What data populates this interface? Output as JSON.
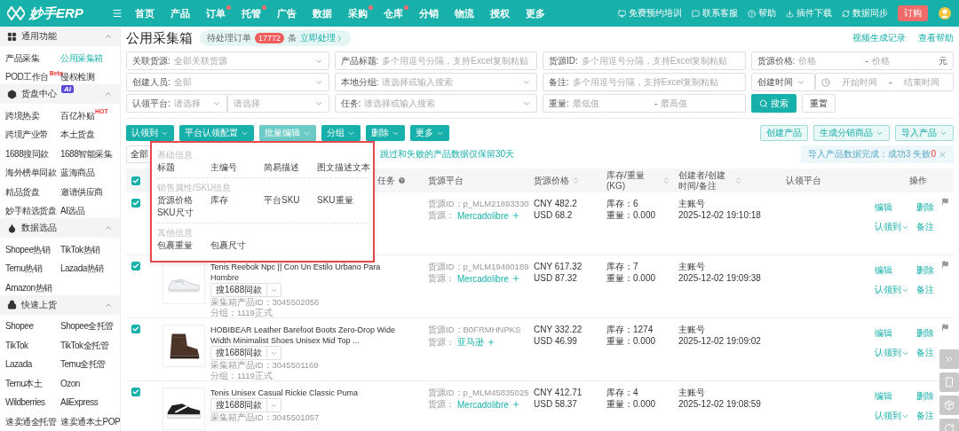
{
  "nav": {
    "logo": "妙手ERP",
    "items": [
      {
        "label": "首页",
        "dot": false
      },
      {
        "label": "产品",
        "dot": false
      },
      {
        "label": "订单",
        "dot": true
      },
      {
        "label": "托管",
        "dot": true
      },
      {
        "label": "广告",
        "dot": false
      },
      {
        "label": "数据",
        "dot": false
      },
      {
        "label": "采购",
        "dot": true
      },
      {
        "label": "仓库",
        "dot": true
      },
      {
        "label": "分销",
        "dot": false
      },
      {
        "label": "物流",
        "dot": false
      },
      {
        "label": "授权",
        "dot": false
      },
      {
        "label": "更多",
        "dot": false
      }
    ],
    "links": [
      "免费预约培训",
      "联系客服",
      "帮助",
      "插件下载",
      "数据同步"
    ],
    "order_button": "订购"
  },
  "sidebar": {
    "sections": [
      {
        "title": "通用功能",
        "expanded": true,
        "items": [
          {
            "label": "产品采集",
            "selected": false
          },
          {
            "label": "公用采集箱",
            "selected": true
          },
          {
            "label": "POD工作台",
            "badge": "Beta",
            "selected": false
          },
          {
            "label": "侵权检测",
            "selected": false
          }
        ]
      },
      {
        "title": "货盘中心",
        "tag": "AI",
        "expanded": true,
        "items": [
          {
            "label": "跨境热卖",
            "selected": false
          },
          {
            "label": "百亿补贴",
            "badge": "HOT",
            "selected": false
          },
          {
            "label": "跨境产业带",
            "selected": false
          },
          {
            "label": "本土货盘",
            "selected": false
          },
          {
            "label": "1688搜同款",
            "selected": false
          },
          {
            "label": "1688智能采集",
            "selected": false
          },
          {
            "label": "海外榜单同款",
            "selected": false
          },
          {
            "label": "蓝海商品",
            "selected": false
          },
          {
            "label": "精品货盘",
            "selected": false
          },
          {
            "label": "邀请供应商",
            "selected": false
          },
          {
            "label": "妙手精选货盘",
            "selected": false
          },
          {
            "label": "AI选品",
            "selected": false
          }
        ]
      },
      {
        "title": "数据选品",
        "expanded": true,
        "items": [
          {
            "label": "Shopee热销",
            "selected": false
          },
          {
            "label": "TikTok热销",
            "selected": false
          },
          {
            "label": "Temu热销",
            "selected": false
          },
          {
            "label": "Lazada热销",
            "selected": false
          },
          {
            "label": "Amazon热销",
            "selected": false
          }
        ]
      },
      {
        "title": "快速上货",
        "expanded": true,
        "items": [
          {
            "label": "Shopee",
            "selected": false
          },
          {
            "label": "Shopee全托管",
            "selected": false
          },
          {
            "label": "TikTok",
            "selected": false
          },
          {
            "label": "TikTok全托管",
            "selected": false
          },
          {
            "label": "Lazada",
            "selected": false
          },
          {
            "label": "Temu全托管",
            "selected": false
          },
          {
            "label": "Temu本土",
            "selected": false
          },
          {
            "label": "Ozon",
            "selected": false
          },
          {
            "label": "Wildberries",
            "selected": false
          },
          {
            "label": "AliExpress",
            "selected": false
          },
          {
            "label": "速卖通全托管",
            "selected": false
          },
          {
            "label": "速卖通本土POP",
            "selected": false
          }
        ]
      }
    ]
  },
  "page": {
    "title": "公用采集箱",
    "pending": {
      "label": "待处理订单",
      "count": "17772",
      "unit": "条",
      "action": "立即处理"
    },
    "links": [
      "视频生成记录",
      "查看帮助"
    ]
  },
  "filters": [
    [
      {
        "kind": "select",
        "label": "关联货源:",
        "placeholder": "全部关联货源"
      },
      {
        "kind": "text",
        "label": "产品标题:",
        "placeholder": "多个用逗号分隔，支持Excel复制粘贴"
      },
      {
        "kind": "text",
        "label": "货源ID:",
        "placeholder": "多个用逗号分隔，支持Excel复制粘贴"
      },
      {
        "kind": "range",
        "label": "货源价格:",
        "from": "价格",
        "separator": "-",
        "to": "价格",
        "unit": "元"
      }
    ],
    [
      {
        "kind": "select",
        "label": "创建人员:",
        "placeholder": "全部"
      },
      {
        "kind": "select",
        "label": "本地分组:",
        "placeholder": "请选择或输入搜索"
      },
      {
        "kind": "text",
        "label": "备注:",
        "placeholder": "多个用逗号分隔，支持Excel复制粘贴"
      },
      {
        "kind": "date-range",
        "label": "创建时间",
        "from": "开始时间",
        "separator": "-",
        "to": "结束时间"
      }
    ],
    [
      {
        "kind": "split-select",
        "label": "认领平台:",
        "first": "请选择",
        "second": "请选择"
      },
      {
        "kind": "select",
        "label": "任务:",
        "placeholder": "请选择或输入搜索"
      },
      {
        "kind": "range",
        "label": "重量:",
        "from": "最低值",
        "separator": "-",
        "to": "最高值"
      },
      {
        "kind": "actions",
        "buttons": [
          "搜索",
          "重置"
        ]
      }
    ]
  ],
  "toolbar": {
    "left": [
      {
        "label": "认领到",
        "open": false
      },
      {
        "label": "平台认领配置",
        "open": false
      },
      {
        "label": "批量编辑",
        "open": true
      },
      {
        "label": "分组",
        "open": false
      },
      {
        "label": "删除",
        "open": false
      },
      {
        "label": "更多",
        "open": false
      }
    ],
    "right": [
      {
        "label": "创建产品",
        "caret": false
      },
      {
        "label": "生成分销商品",
        "caret": true
      },
      {
        "label": "导入产品",
        "caret": true
      }
    ]
  },
  "batch_edit_menu": {
    "groups": [
      {
        "title": "基础信息",
        "items": [
          "标题",
          "主编号",
          "简易描述",
          "图文描述文本"
        ]
      },
      {
        "title": "销售属性/SKU信息",
        "items": [
          "货源价格",
          "库存",
          "平台SKU",
          "SKU重量",
          "SKU尺寸"
        ]
      },
      {
        "title": "其他信息",
        "items": [
          "包裹重量",
          "包裹尺寸"
        ]
      }
    ]
  },
  "status_tab": "全部",
  "notice": "跳过和失败的产品数据仅保留30天",
  "import_status": {
    "text": "导入产品数据完成：成功3 失败",
    "failed": "0"
  },
  "table": {
    "all_checked": true,
    "columns": [
      {
        "label": "任务",
        "help": true,
        "sortable": false
      },
      {
        "label": "货源平台",
        "help": false,
        "sortable": false
      },
      {
        "label": "货源价格",
        "help": false,
        "sortable": true
      },
      {
        "label": "库存/重量(KG)",
        "help": false,
        "sortable": true
      },
      {
        "label": "创建者/创建时间/备注",
        "help": false,
        "sortable": true
      },
      {
        "label": "认领平台",
        "help": false,
        "sortable": false
      },
      {
        "label": "操作",
        "help": false,
        "sortable": false
      }
    ],
    "rows": [
      {
        "checked": true,
        "source_id": "货源ID：p_MLM21893330",
        "source_label": "货源：",
        "source": "Mercadolibre",
        "price_cny": "CNY 482.2",
        "price_usd": "USD 68.2",
        "stock": "库存：6",
        "weight": "重量：0.000",
        "creator": "主账号",
        "created": "2025-12-02 19:10:18",
        "actions": [
          "编辑",
          "删除",
          "认领到",
          "备注"
        ]
      },
      {
        "checked": true,
        "product": {
          "title": "Tenis Reebok Npc || Con Un Estilo Urbano Para Hombre",
          "search_button": "搜1688同款",
          "product_id": "采集箱产品ID：3045502056",
          "group": "分组：1119正式"
        },
        "source_id": "货源ID：p_MLM19480189",
        "source_label": "货源：",
        "source": "Mercadolibre",
        "price_cny": "CNY 617.32",
        "price_usd": "USD 87.32",
        "stock": "库存：7",
        "weight": "重量：0.000",
        "creator": "主账号",
        "created": "2025-12-02 19:09:38",
        "actions": [
          "编辑",
          "删除",
          "认领到",
          "备注"
        ]
      },
      {
        "checked": true,
        "product": {
          "title": "HOBIBEAR Leather Barefoot Boots Zero-Drop Wide Width Minimalist Shoes Unisex Mid Top ...",
          "search_button": "搜1688同款",
          "product_id": "采集箱产品ID：3045501169",
          "group": "分组：1119正式"
        },
        "source_id": "货源ID：B0FRMHNPKS",
        "source_label": "货源：",
        "source": "亚马逊",
        "price_cny": "CNY 332.22",
        "price_usd": "USD 46.99",
        "stock": "库存：1274",
        "weight": "重量：0.000",
        "creator": "主账号",
        "created": "2025-12-02 19:09:02",
        "actions": [
          "编辑",
          "删除",
          "认领到",
          "备注"
        ]
      },
      {
        "checked": true,
        "product": {
          "title": "Tenis Unisex Casual Rickie Classic Puma",
          "search_button": "搜1688同款",
          "product_id": "采集箱产品ID：3045501057"
        },
        "source_id": "货源ID：p_MLM45835025",
        "source_label": "货源：",
        "source": "Mercadolibre",
        "price_cny": "CNY 412.71",
        "price_usd": "USD 58.37",
        "stock": "库存：4",
        "weight": "重量：0.000",
        "creator": "主账号",
        "created": "2025-12-02 19:08:59",
        "actions": [
          "编辑",
          "删除",
          "认领到",
          "备注"
        ]
      }
    ]
  }
}
